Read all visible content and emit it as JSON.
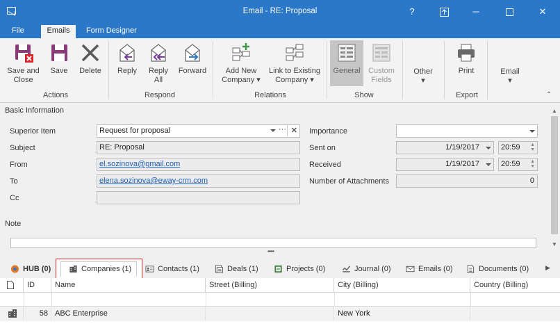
{
  "window": {
    "title": "Email - RE: Proposal",
    "help": "?",
    "minimize": "─",
    "close": "✕"
  },
  "ribbon_tabs": [
    "File",
    "Emails",
    "Form Designer"
  ],
  "ribbon": {
    "save_and_close": "Save and\nClose",
    "save": "Save",
    "delete": "Delete",
    "reply": "Reply",
    "reply_all": "Reply\nAll",
    "forward": "Forward",
    "add_new_company": "Add New\nCompany ▾",
    "link_to_existing_company": "Link to Existing\nCompany ▾",
    "general": "General",
    "custom_fields": "Custom\nFields",
    "other": "Other\n▾",
    "print": "Print",
    "email": "Email\n▾",
    "groups": {
      "actions": "Actions",
      "respond": "Respond",
      "relations": "Relations",
      "show": "Show",
      "export": "Export"
    }
  },
  "form": {
    "section": "Basic Information",
    "superior_item_label": "Superior Item",
    "superior_item_value": "Request for proposal",
    "subject_label": "Subject",
    "subject_value": "RE: Proposal",
    "from_label": "From",
    "from_value": "el.sozinova@gmail.com",
    "to_label": "To",
    "to_value": "elena.sozinova@eway-crm.com",
    "cc_label": "Cc",
    "cc_value": "",
    "importance_label": "Importance",
    "importance_value": "",
    "sent_on_label": "Sent on",
    "sent_on_date": "1/19/2017",
    "sent_on_time": "20:59",
    "received_label": "Received",
    "received_date": "1/19/2017",
    "received_time": "20:59",
    "attachments_label": "Number of Attachments",
    "attachments_value": "0",
    "note_label": "Note",
    "note_value": "",
    "splitter": "•••••"
  },
  "detail_tabs": {
    "hub": "HUB (0)",
    "companies": "Companies (1)",
    "contacts": "Contacts (1)",
    "deals": "Deals (1)",
    "projects": "Projects (0)",
    "journal": "Journal (0)",
    "emails": "Emails (0)",
    "documents": "Documents (0)"
  },
  "grid": {
    "columns": [
      "ID",
      "Name",
      "Street (Billing)",
      "City (Billing)",
      "Country (Billing)"
    ],
    "rows": [
      {
        "id": "58",
        "name": "ABC Enterprise",
        "street": "",
        "city": "New York",
        "country": ""
      }
    ]
  },
  "colors": {
    "titlebar": "#2b78c9",
    "highlight_border": "#d9262c"
  }
}
